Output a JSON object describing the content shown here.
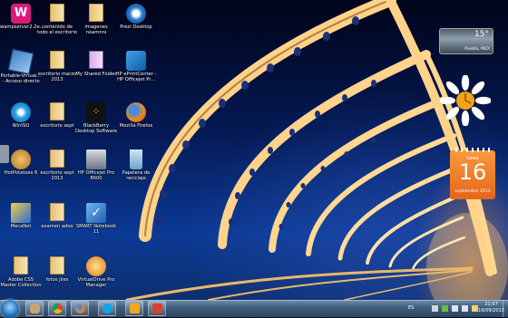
{
  "desktop_icons": [
    {
      "label": "wampserver2.2e...",
      "icon": "wamp-icon"
    },
    {
      "label": "contenido de todo el escritorio",
      "icon": "folder-icon"
    },
    {
      "label": "imagenes noamnni",
      "icon": "folder-icon"
    },
    {
      "label": "Prezi Desktop",
      "icon": "prezi-icon"
    },
    {
      "label": "Portable-Virtual... - Acceso directo",
      "icon": "virtualbox-icon"
    },
    {
      "label": "escritorio marzo 2013",
      "icon": "folder-icon"
    },
    {
      "label": "My Shared Folder",
      "icon": "shared-folder-icon"
    },
    {
      "label": "HP ePrintCenter - HP Officejet Pr...",
      "icon": "hp-eprint-icon"
    },
    {
      "label": "WinISO",
      "icon": "winiso-icon"
    },
    {
      "label": "escritorio sept",
      "icon": "folder-icon"
    },
    {
      "label": "BlackBerry Desktop Software",
      "icon": "blackberry-icon"
    },
    {
      "label": "Mozilla Firefox",
      "icon": "firefox-icon"
    },
    {
      "label": "HotPotatoes 6",
      "icon": "hotpotatoes-icon"
    },
    {
      "label": "escritorio sept 2013",
      "icon": "folder-icon"
    },
    {
      "label": "HP Officejet Pro 8600",
      "icon": "printer-icon"
    },
    {
      "label": "Papelera de reciclaje",
      "icon": "recycle-bin-icon"
    },
    {
      "label": "MecaNet",
      "icon": "mecanet-icon"
    },
    {
      "label": "examen adoo",
      "icon": "folder-icon"
    },
    {
      "label": "SMART Notebook 11",
      "icon": "smart-notebook-icon"
    },
    {
      "label": "Adobe CS5 Master Collection",
      "icon": "folder-icon"
    },
    {
      "label": "fotos jiles",
      "icon": "folder-icon"
    },
    {
      "label": "VirtualDrive Pro Manager",
      "icon": "virtualdrive-icon"
    }
  ],
  "gadgets": {
    "weather": {
      "temp": "15°",
      "city": "Puebla, MEX"
    },
    "calendar": {
      "weekday": "lunes",
      "day": "16",
      "month_year": "septiembre 2013"
    },
    "clock": {
      "icon": "daisy-clock-icon"
    }
  },
  "taskbar": {
    "start_icon": "windows-start-icon",
    "pinned": [
      {
        "icon": "hand-app-icon"
      },
      {
        "icon": "chrome-icon"
      },
      {
        "icon": "firefox-icon"
      },
      {
        "icon": "skype-icon"
      },
      {
        "icon": "outlook-icon"
      },
      {
        "icon": "powerpoint-icon"
      }
    ],
    "tray": {
      "language": "ES",
      "time": "21:57",
      "date": "16/09/2013"
    }
  },
  "colors": {
    "calendar_orange": "#ee7a2b",
    "taskbar": "#3f5f7d"
  }
}
